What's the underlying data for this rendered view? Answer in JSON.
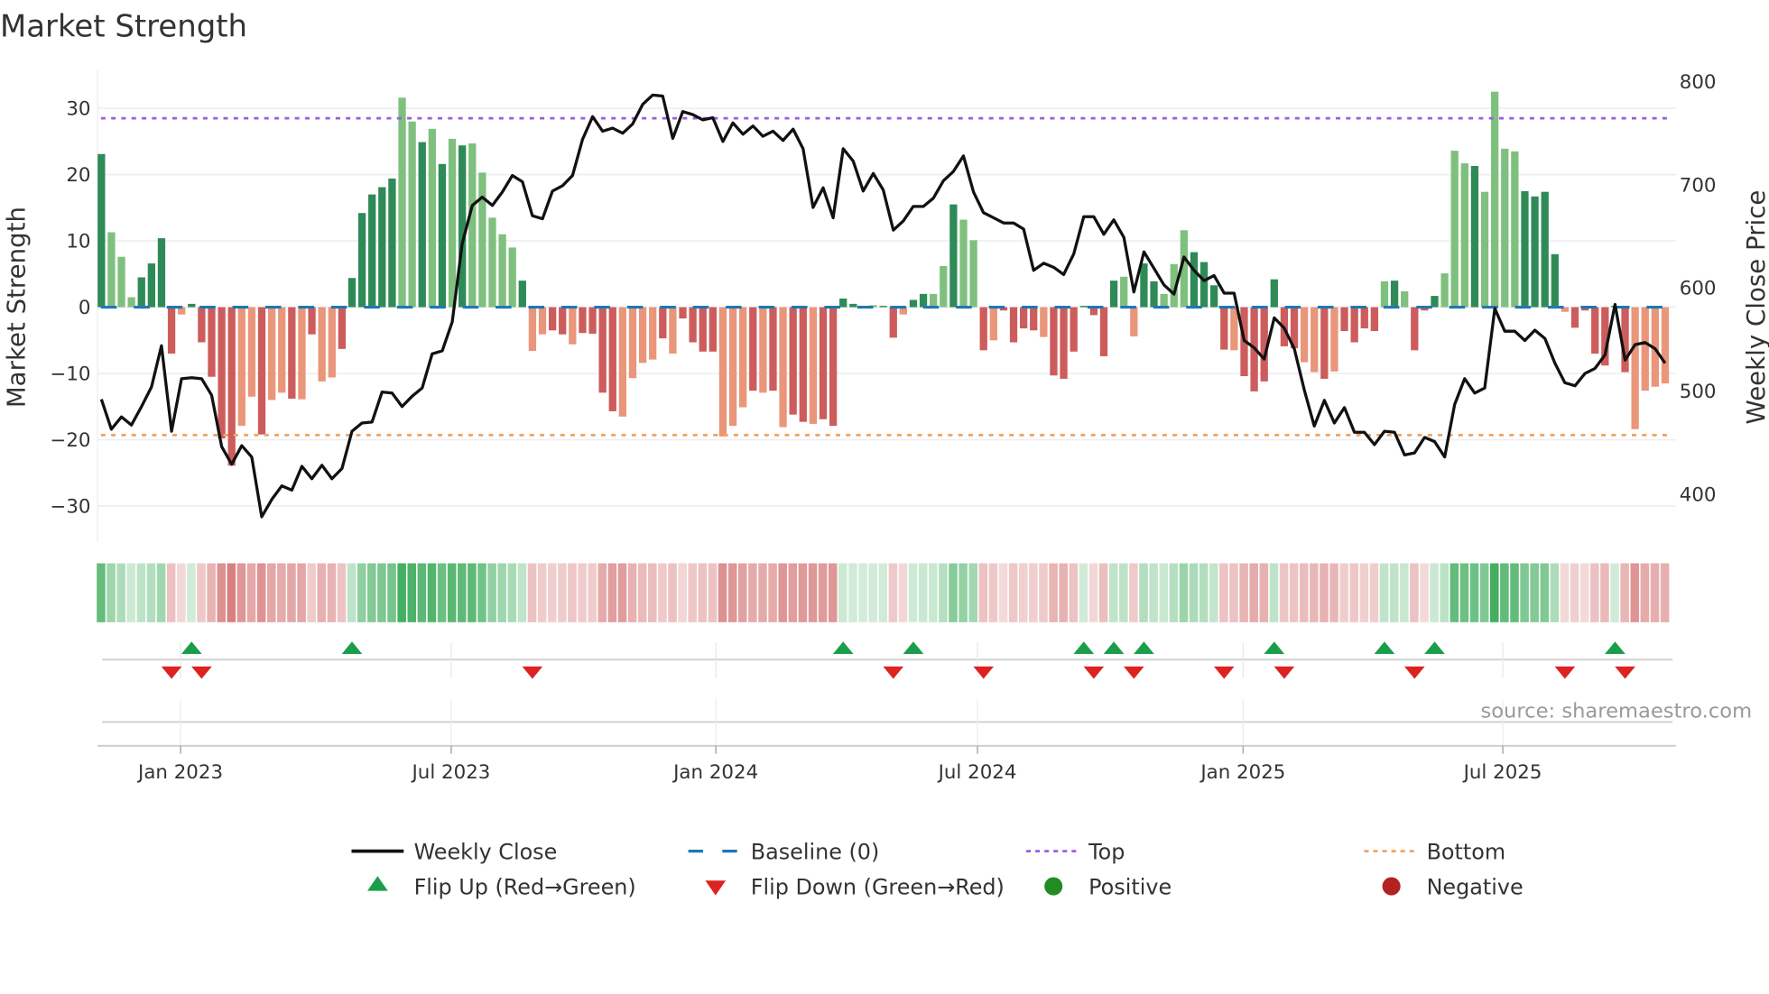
{
  "title": "Market Strength",
  "source": "source: sharemaestro.com",
  "colors": {
    "strong_green": "#2e8b57",
    "light_green": "#7fc07f",
    "strong_red": "#cd5c5c",
    "light_red": "#e9967a",
    "close_line": "#111111",
    "baseline": "#1f77b4",
    "top": "#9b5de5",
    "bottom": "#f4a261",
    "flip_up": "#1a9e4a",
    "flip_down": "#dd2222",
    "positive": "#228b22",
    "negative": "#b22222",
    "heat_green": "#34a853",
    "heat_red": "#cd5c5c"
  },
  "legend": [
    {
      "label": "Weekly Close",
      "kind": "solid-line"
    },
    {
      "label": "Baseline (0)",
      "kind": "dashed-line"
    },
    {
      "label": "Top",
      "kind": "dotted-line-top"
    },
    {
      "label": "Bottom",
      "kind": "dotted-line-bottom"
    },
    {
      "label": "Flip Up (Red→Green)",
      "kind": "triangle-up"
    },
    {
      "label": "Flip Down (Green→Red)",
      "kind": "triangle-down"
    },
    {
      "label": "Positive",
      "kind": "dot-positive"
    },
    {
      "label": "Negative",
      "kind": "dot-negative"
    }
  ],
  "chart_data": {
    "type": "bar+line",
    "title": "Market Strength",
    "left_axis": {
      "label": "Market Strength",
      "range": [
        -35.5,
        35.7
      ],
      "ticks": [
        {
          "value": -30,
          "label": "−30"
        },
        {
          "value": -20,
          "label": "−20"
        },
        {
          "value": -10,
          "label": "−10"
        },
        {
          "value": 0,
          "label": "0"
        },
        {
          "value": 10,
          "label": "10"
        },
        {
          "value": 20,
          "label": "20"
        },
        {
          "value": 30,
          "label": "30"
        }
      ]
    },
    "right_axis": {
      "label": "Weekly Close Price",
      "range": [
        355,
        800
      ],
      "ticks": [
        {
          "value": 400,
          "label": "400"
        },
        {
          "value": 500,
          "label": "500"
        },
        {
          "value": 600,
          "label": "600"
        },
        {
          "value": 700,
          "label": "700"
        },
        {
          "value": 800,
          "label": "800"
        }
      ]
    },
    "x_ticks": [
      {
        "index": 7.9,
        "label": "Jan 2023"
      },
      {
        "index": 34.9,
        "label": "Jul 2023"
      },
      {
        "index": 61.3,
        "label": "Jan 2024"
      },
      {
        "index": 87.4,
        "label": "Jul 2024"
      },
      {
        "index": 113.9,
        "label": "Jan 2025"
      },
      {
        "index": 139.8,
        "label": "Jul 2025"
      }
    ],
    "grid": true,
    "legend_position": "bottom",
    "top_level": 28.5,
    "bottom_level": -19.3,
    "baseline": 0,
    "strength": [
      23.1,
      11.3,
      7.6,
      1.5,
      4.5,
      6.6,
      10.4,
      -7.0,
      -1.1,
      0.5,
      -5.3,
      -10.5,
      -19.8,
      -23.9,
      -17.9,
      -13.5,
      -19.2,
      -14,
      -12.9,
      -13.8,
      -13.9,
      -4.1,
      -11.2,
      -10.6,
      -6.3,
      4.4,
      14.2,
      17,
      18.1,
      19.4,
      31.6,
      28,
      24.9,
      26.9,
      21.6,
      25.4,
      24.4,
      24.7,
      20.3,
      13.5,
      11,
      9,
      4,
      -6.6,
      -4.1,
      -3.5,
      -4.1,
      -5.6,
      -3.9,
      -4,
      -12.9,
      -15.7,
      -16.5,
      -10.7,
      -8.4,
      -7.9,
      -4.7,
      -7,
      -1.7,
      -5.3,
      -6.7,
      -6.7,
      -19.5,
      -17.9,
      -15.1,
      -12.6,
      -12.9,
      -12.6,
      -18.1,
      -16.2,
      -17.3,
      -17.6,
      -16.9,
      -17.9,
      1.3,
      0.5,
      0.1,
      0.3,
      0.2,
      -4.6,
      -1.1,
      1.1,
      2,
      2,
      6.2,
      15.5,
      13.2,
      10.1,
      -6.5,
      -5,
      -0.5,
      -5.3,
      -3.2,
      -3.5,
      -4.5,
      -10.3,
      -10.8,
      -6.7,
      0.2,
      -1.2,
      -7.4,
      4,
      4.6,
      -4.4,
      6.6,
      3.9,
      2,
      6.5,
      11.6,
      8.3,
      6.8,
      3.3,
      -6.4,
      -6.5,
      -10.4,
      -12.7,
      -11.2,
      4.2,
      -5.9,
      -6.2,
      -8.3,
      -9.8,
      -10.8,
      -9.7,
      -3.6,
      -5.3,
      -3.2,
      -3.6,
      3.9,
      4,
      2.4,
      -6.5,
      -0.5,
      1.7,
      5.1,
      23.6,
      21.7,
      21.3,
      17.4,
      32.5,
      23.9,
      23.5,
      17.5,
      16.7,
      17.4,
      8,
      -0.7,
      -3.1,
      -0.5,
      -7,
      -8.8,
      0.2,
      -9.8,
      -18.4,
      -12.6,
      -12,
      -11.5
    ],
    "shade": "dlllddddldddddlldlldldllddddddlldldldllllldllddlddddlllldlddddllldldlddldddddlddlddlldlldlddddldddddddllddlllddddlddddddlldlddddldldddllldllllddddlddddddlll",
    "weekly_close": [
      492,
      463,
      475,
      467,
      485,
      504,
      544,
      461,
      512,
      513,
      512,
      496,
      446,
      429,
      447,
      436,
      378,
      395,
      408,
      404,
      427,
      415,
      428,
      415,
      425,
      461,
      469,
      470,
      499,
      498,
      485,
      495,
      503,
      536,
      539,
      567,
      643,
      680,
      688,
      680,
      693,
      709,
      703,
      670,
      667,
      694,
      699,
      709,
      744,
      766,
      752,
      755,
      750,
      759,
      778,
      787,
      786,
      745,
      771,
      768,
      763,
      765,
      742,
      760,
      749,
      757,
      747,
      752,
      743,
      754,
      735,
      678,
      697,
      668,
      735,
      723,
      694,
      711,
      695,
      656,
      665,
      679,
      679,
      687,
      704,
      713,
      728,
      693,
      673,
      668,
      663,
      663,
      657,
      617,
      624,
      620,
      613,
      633,
      669,
      669,
      652,
      666,
      649,
      596,
      635,
      619,
      603,
      594,
      630,
      617,
      607,
      612,
      595,
      595,
      549,
      542,
      531,
      571,
      561,
      541,
      501,
      466,
      491,
      469,
      484,
      460,
      460,
      448,
      461,
      460,
      438,
      440,
      455,
      451,
      436,
      487,
      512,
      498,
      503,
      580,
      558,
      558,
      549,
      559,
      551,
      527,
      508,
      505,
      517,
      522,
      535,
      584,
      530,
      545,
      547,
      541,
      527
    ],
    "flip_up": [
      9,
      25,
      74,
      81,
      98,
      101,
      104,
      117,
      128,
      133,
      151
    ],
    "flip_down": [
      7,
      10,
      43,
      79,
      88,
      99,
      103,
      112,
      118,
      131,
      146,
      152
    ]
  }
}
